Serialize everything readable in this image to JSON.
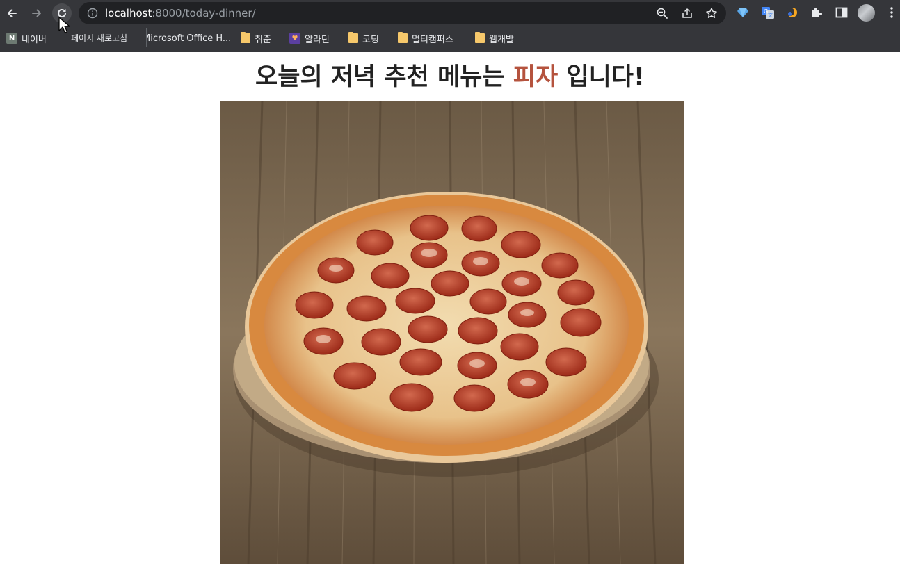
{
  "browser": {
    "url_host": "localhost",
    "url_path": ":8000/today-dinner/",
    "reload_tooltip": "페이지 새로고침"
  },
  "bookmarks": [
    {
      "label": "네이버",
      "icon": "naver-icon"
    },
    {
      "label": "Microsoft Office H...",
      "icon": "office-icon"
    },
    {
      "label": "취준",
      "icon": "folder-icon"
    },
    {
      "label": "알라딘",
      "icon": "aladin-icon"
    },
    {
      "label": "코딩",
      "icon": "folder-icon"
    },
    {
      "label": "멀티캠퍼스",
      "icon": "folder-icon"
    },
    {
      "label": "웹개발",
      "icon": "folder-icon"
    }
  ],
  "page": {
    "headline_before": "오늘의 저녁 추천 메뉴는 ",
    "menu_name": "피자",
    "headline_after": " 입니다!",
    "menu_color": "#b5533e"
  },
  "photo": {
    "subject": "pepperoni pizza on wooden board"
  }
}
